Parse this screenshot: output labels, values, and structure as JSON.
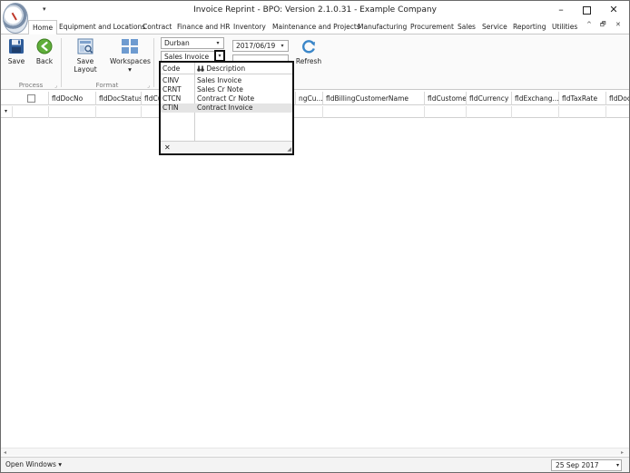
{
  "window": {
    "title": "Invoice Reprint - BPO: Version 2.1.0.31 - Example Company",
    "minimize": "–",
    "close": "✕"
  },
  "qat": {
    "arrow": "▾"
  },
  "tabs": [
    "Home",
    "Equipment and Locations",
    "Contract",
    "Finance and HR",
    "Inventory",
    "Maintenance and Projects",
    "Manufacturing",
    "Procurement",
    "Sales",
    "Service",
    "Reporting",
    "Utilities"
  ],
  "ribbon_controls": {
    "collapse": "^",
    "restore": "🗗",
    "close": "✕"
  },
  "ribbon": {
    "save_label": "Save",
    "back_label": "Back",
    "save_layout_label": "Save Layout",
    "workspaces_label": "Workspaces",
    "workspaces_arrow": "▾",
    "refresh_label": "Refresh",
    "group_process": "Process",
    "group_format": "Format",
    "branch_value": "Durban",
    "doc_type_value": "Sales Invoice",
    "date_value": "2017/06/19",
    "drop_arrow": "▾"
  },
  "grid": {
    "columns": [
      "fldDocNo",
      "fldDocStatus",
      "fldCu",
      "ngCu...",
      "fldBillingCustomerName",
      "fldCustome...",
      "fldCurrency",
      "fldExchang...",
      "fldTaxRate",
      "fldDocD"
    ],
    "filter_indicator": "▾"
  },
  "popup": {
    "header_code": "Code",
    "header_desc": "Description",
    "rows": [
      {
        "code": "CINV",
        "desc": "Sales Invoice"
      },
      {
        "code": "CRNT",
        "desc": "Sales Cr Note"
      },
      {
        "code": "CTCN",
        "desc": "Contract Cr Note"
      },
      {
        "code": "CTIN",
        "desc": "Contract Invoice"
      }
    ],
    "selected_index": 3,
    "close_glyph": "✕",
    "grip_glyph": "◢"
  },
  "statusbar": {
    "open_windows": "Open Windows ▾",
    "date": "25 Sep 2017",
    "date_arrow": "▾"
  },
  "colors": {
    "accent_blue": "#2b79c2",
    "selected_row": "#e4e4e4"
  }
}
